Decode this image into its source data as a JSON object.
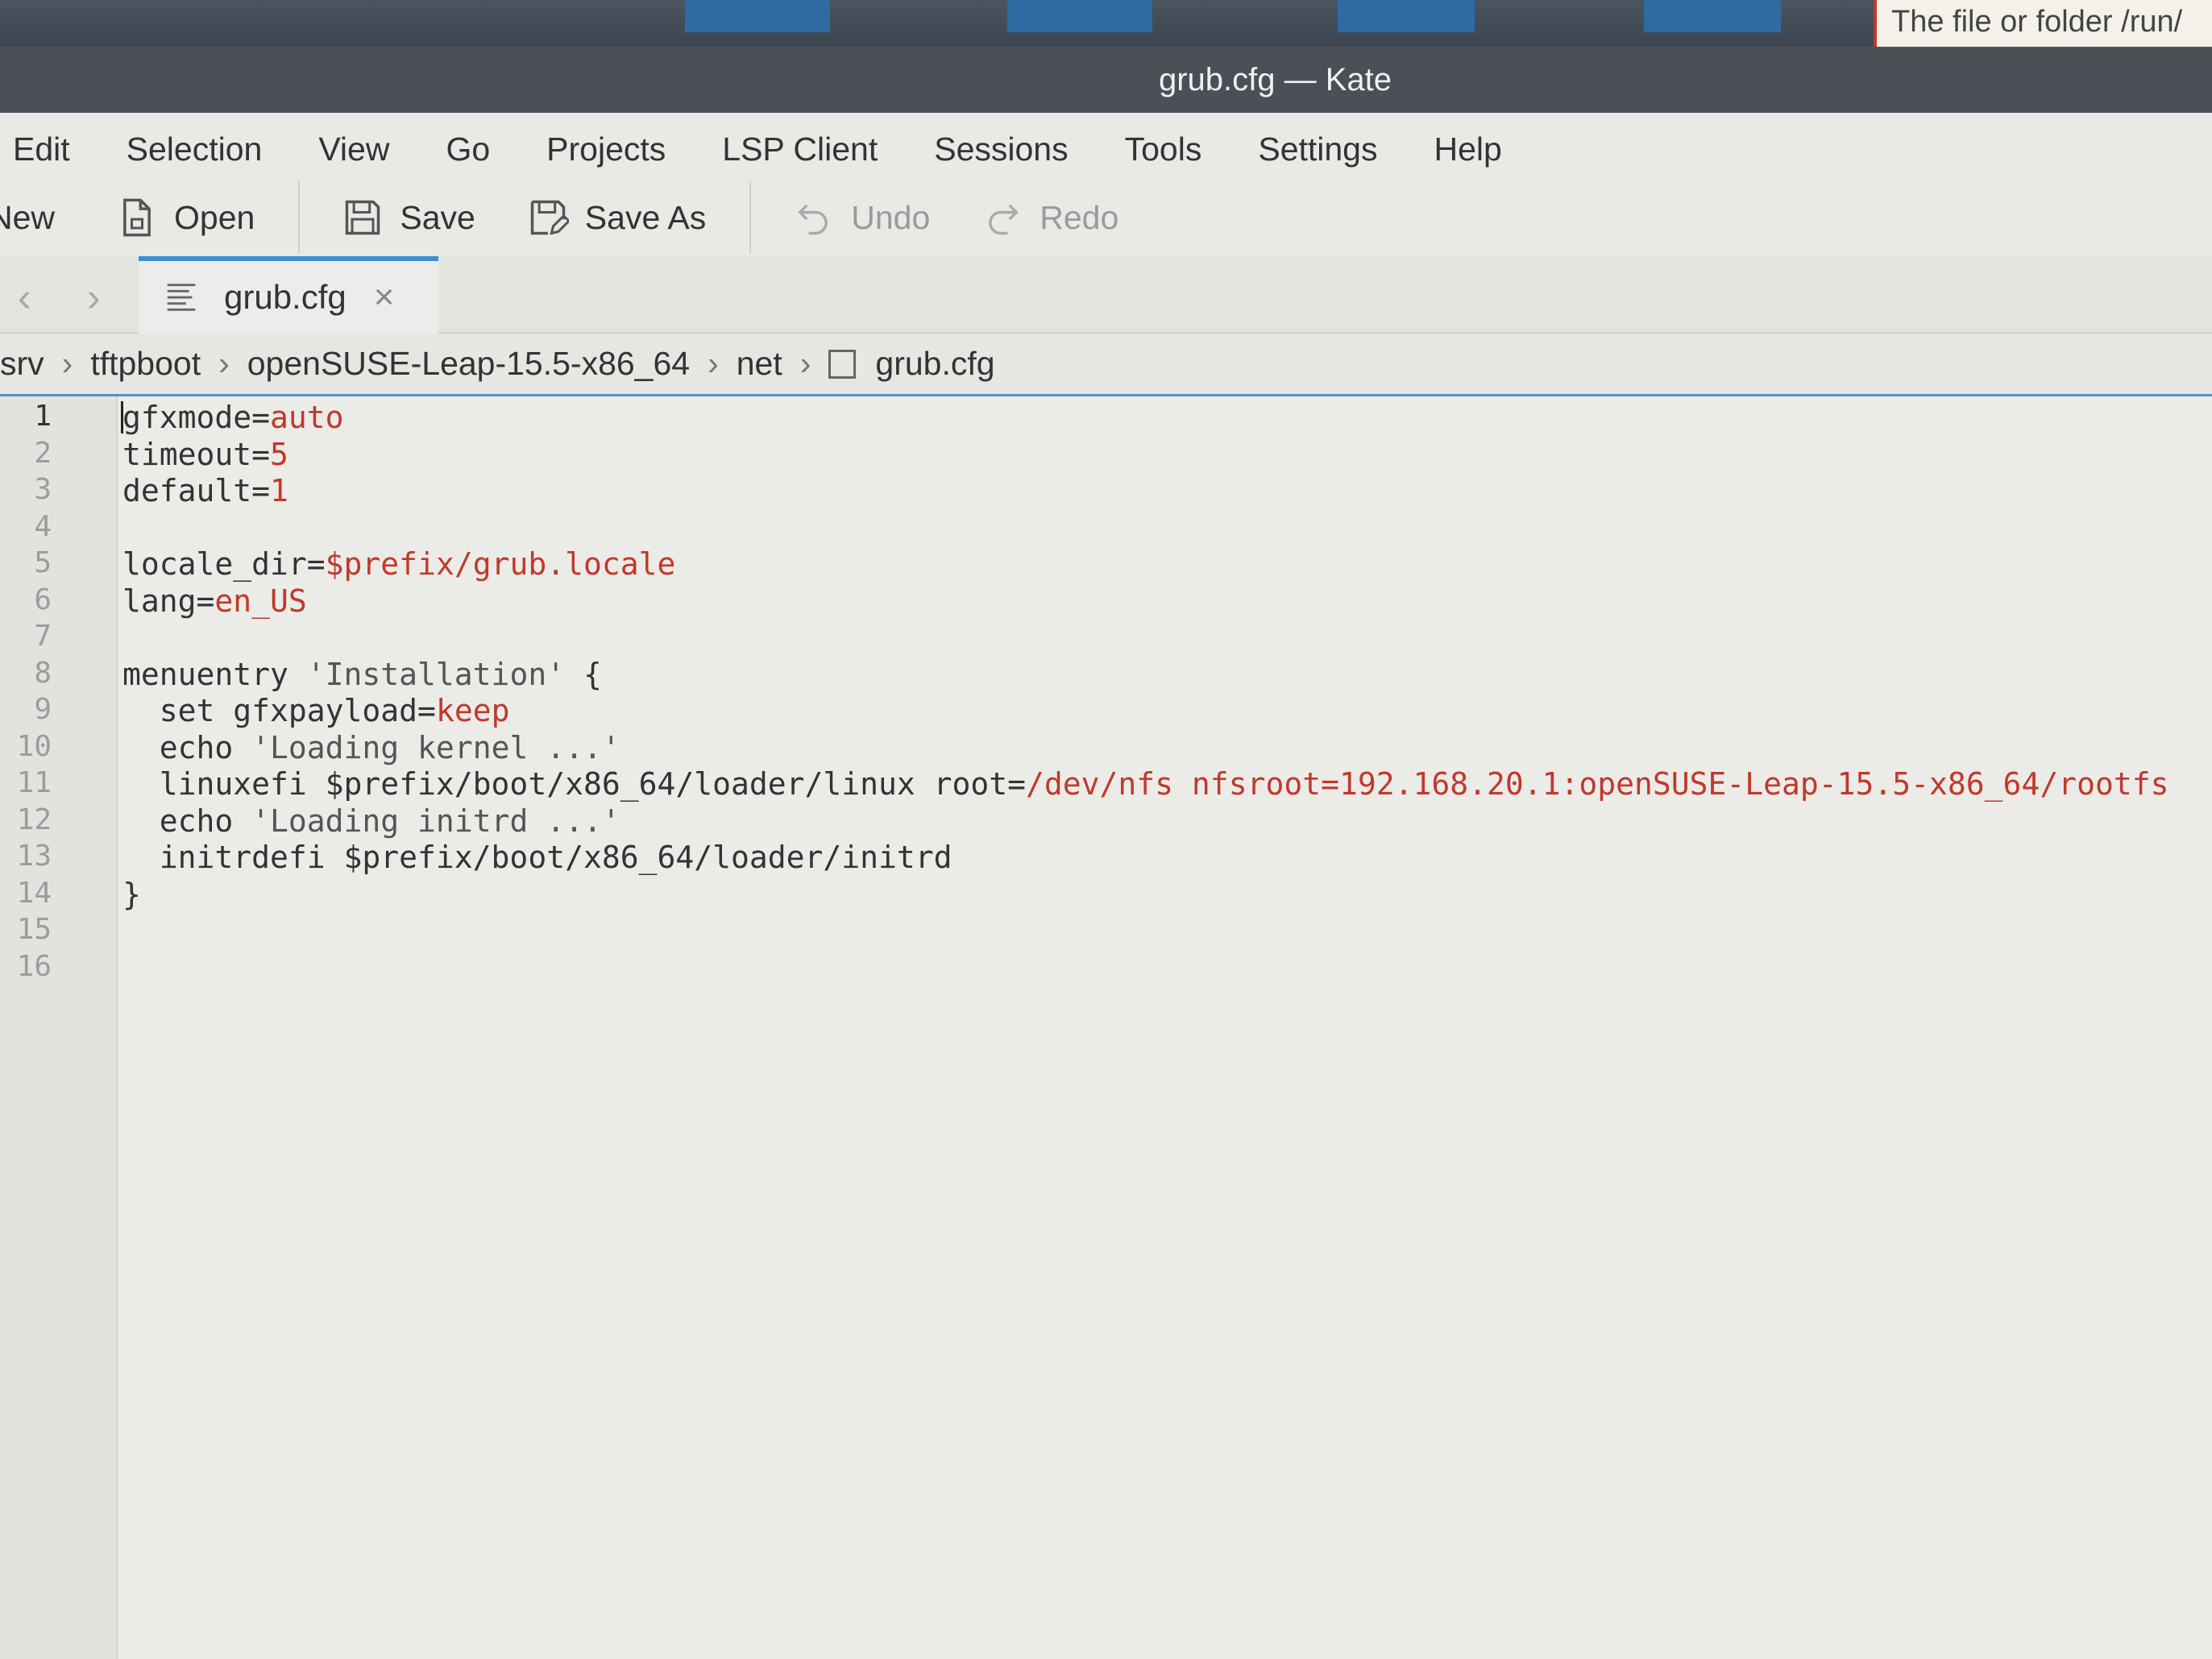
{
  "notification": {
    "text": "The file or folder /run/"
  },
  "window": {
    "title": "grub.cfg — Kate"
  },
  "menu": [
    "Edit",
    "Selection",
    "View",
    "Go",
    "Projects",
    "LSP Client",
    "Sessions",
    "Tools",
    "Settings",
    "Help"
  ],
  "toolbar": {
    "new_label": "New",
    "open_label": "Open",
    "save_label": "Save",
    "save_as_label": "Save As",
    "undo_label": "Undo",
    "redo_label": "Redo"
  },
  "tab": {
    "label": "grub.cfg",
    "close": "×"
  },
  "breadcrumb": [
    "srv",
    "tftpboot",
    "openSUSE-Leap-15.5-x86_64",
    "net",
    "grub.cfg"
  ],
  "editor": {
    "current_line": 1,
    "lines": [
      [
        {
          "t": "gfxmode=",
          "c": "k"
        },
        {
          "t": "auto",
          "c": "v"
        }
      ],
      [
        {
          "t": "timeout=",
          "c": "k"
        },
        {
          "t": "5",
          "c": "v"
        }
      ],
      [
        {
          "t": "default=",
          "c": "k"
        },
        {
          "t": "1",
          "c": "v"
        }
      ],
      [],
      [
        {
          "t": "locale_dir=",
          "c": "k"
        },
        {
          "t": "$prefix/grub.locale",
          "c": "v"
        }
      ],
      [
        {
          "t": "lang=",
          "c": "k"
        },
        {
          "t": "en_US",
          "c": "v"
        }
      ],
      [],
      [
        {
          "t": "menuentry ",
          "c": "k"
        },
        {
          "t": "'Installation'",
          "c": "s"
        },
        {
          "t": " {",
          "c": "k"
        }
      ],
      [
        {
          "t": "  set gfxpayload=",
          "c": "k"
        },
        {
          "t": "keep",
          "c": "v"
        }
      ],
      [
        {
          "t": "  echo ",
          "c": "k"
        },
        {
          "t": "'Loading kernel ...'",
          "c": "s"
        }
      ],
      [
        {
          "t": "  linuxefi $prefix/boot/x86_64/loader/linux root=",
          "c": "k"
        },
        {
          "t": "/dev/nfs nfsroot=192.168.20.1:openSUSE-Leap-15.5-x86_64/rootfs",
          "c": "v"
        }
      ],
      [
        {
          "t": "  echo ",
          "c": "k"
        },
        {
          "t": "'Loading initrd ...'",
          "c": "s"
        }
      ],
      [
        {
          "t": "  initrdefi $prefix/boot/x86_64/loader/initrd",
          "c": "k"
        }
      ],
      [
        {
          "t": "}",
          "c": "k"
        }
      ],
      [],
      []
    ]
  },
  "colors": {
    "accent": "#3d8fd1",
    "value": "#c0392b"
  }
}
